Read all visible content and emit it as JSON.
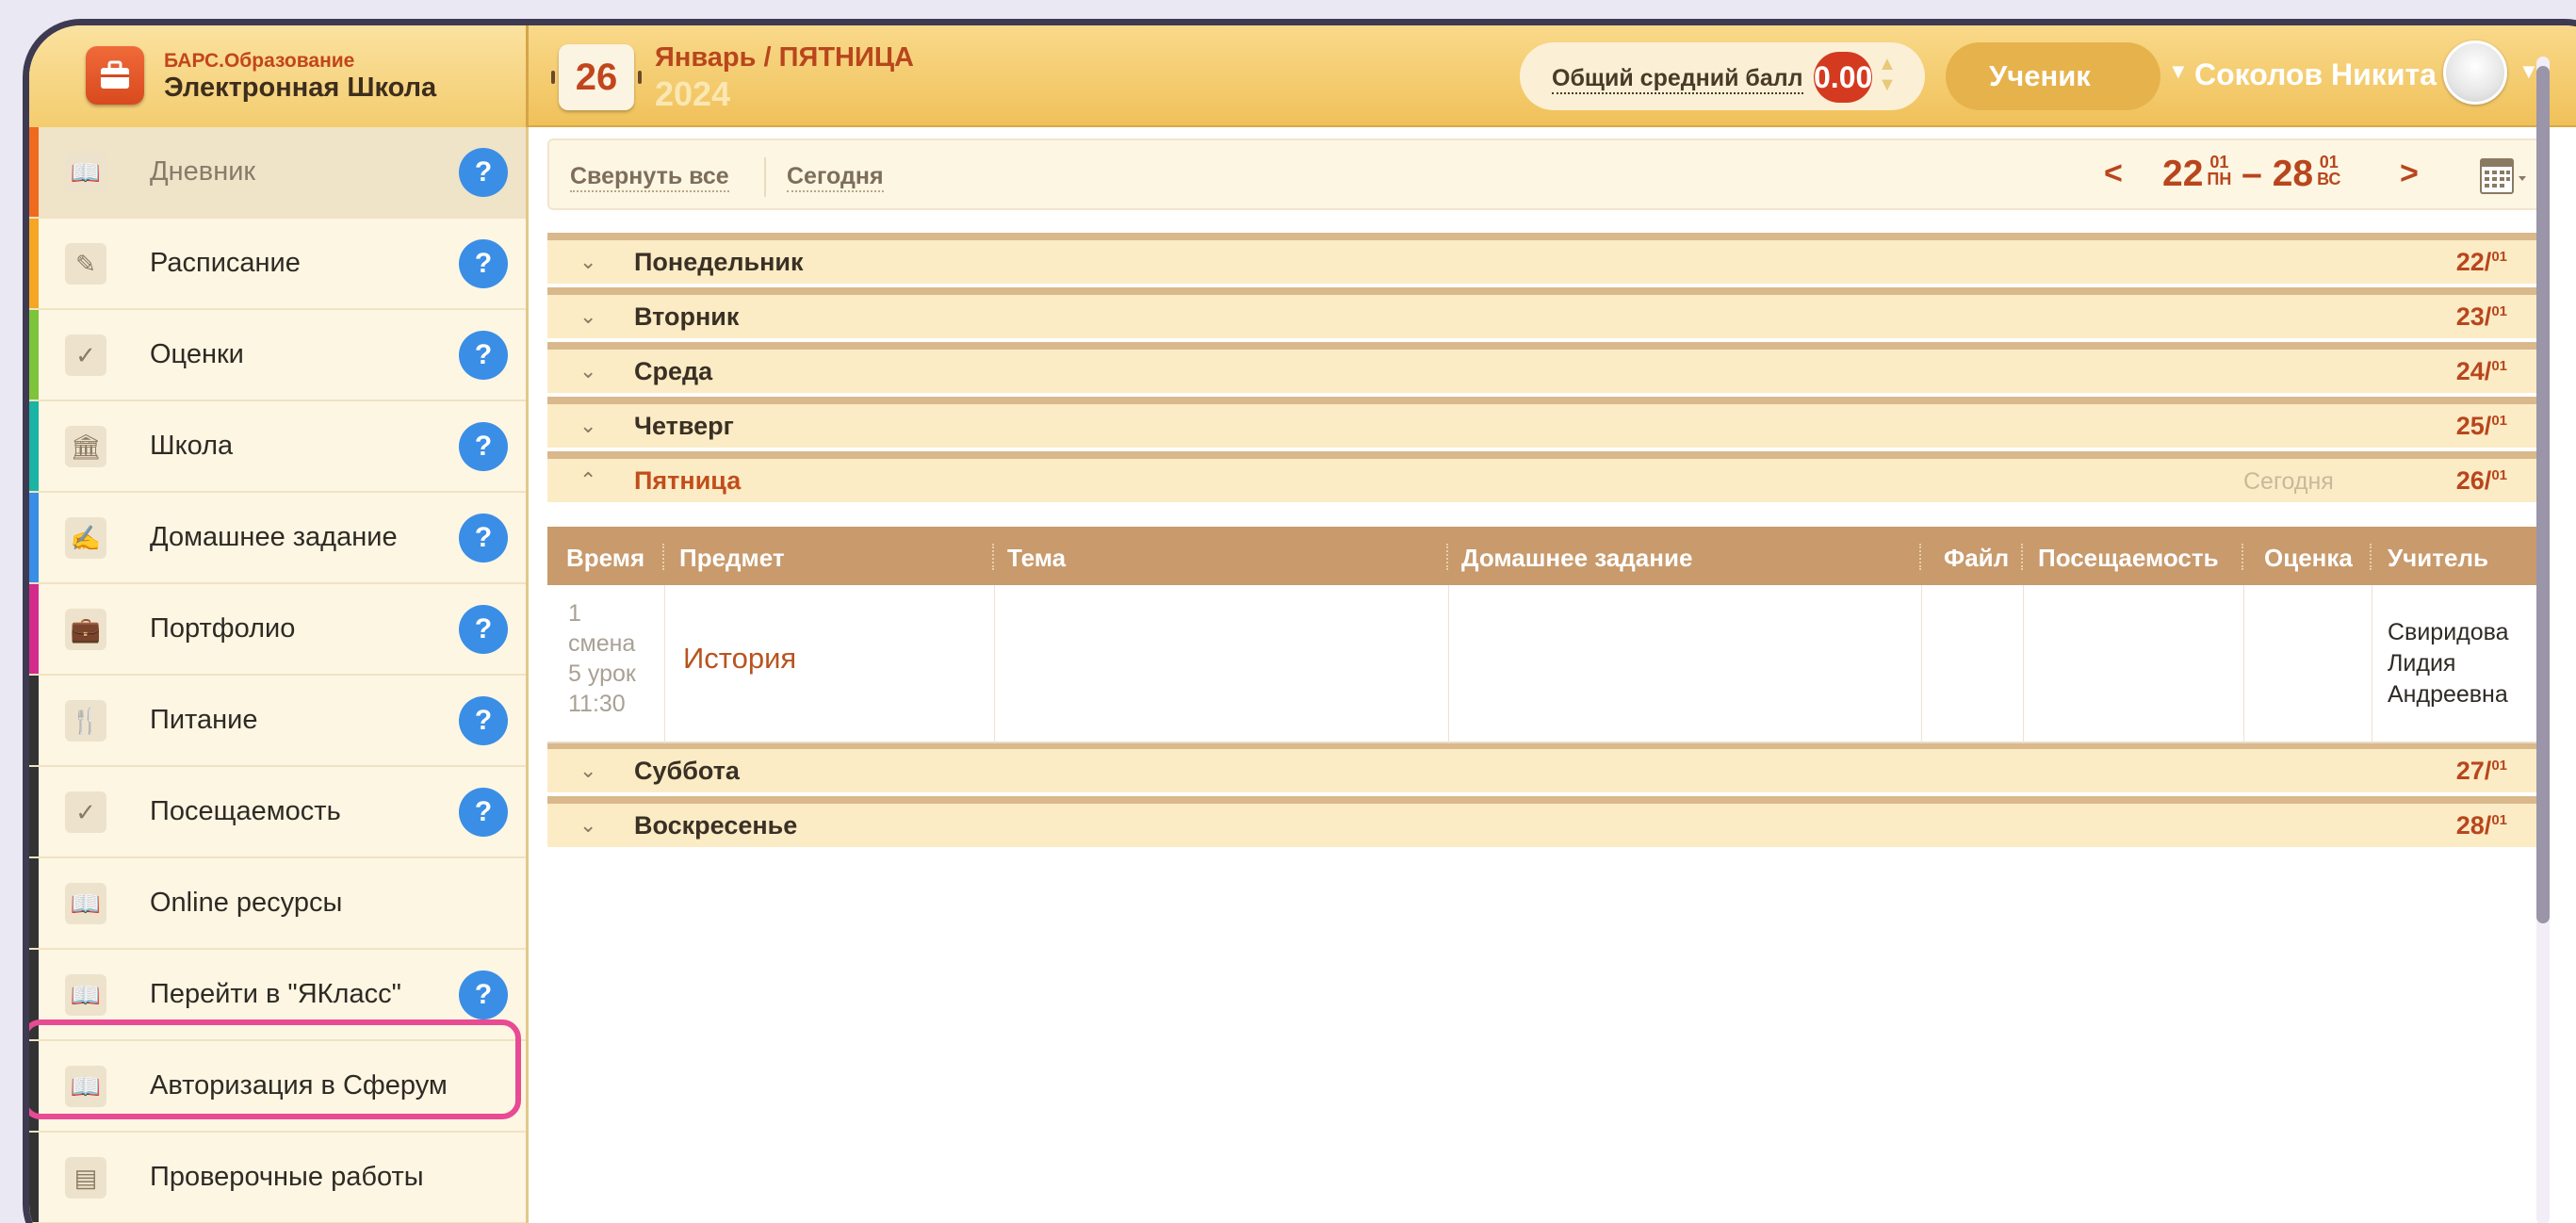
{
  "app": {
    "brand_line1": "БАРС.Образование",
    "brand_line2": "Электронная Школа"
  },
  "header": {
    "day_number": "26",
    "month_weekday": "Январь / ПЯТНИЦА",
    "year": "2024",
    "avg_label": "Общий средний балл",
    "avg_value": "0.00",
    "role": "Ученик",
    "user_name": "Соколов Никита"
  },
  "sidebar": {
    "items": [
      {
        "label": "Дневник",
        "icon": "book-icon",
        "help": "?",
        "stripe": "#f06a1e"
      },
      {
        "label": "Расписание",
        "icon": "pen-icon",
        "help": "?",
        "stripe": "#f5a623"
      },
      {
        "label": "Оценки",
        "icon": "check-icon",
        "help": "?",
        "stripe": "#7dc43a"
      },
      {
        "label": "Школа",
        "icon": "school-icon",
        "help": "?",
        "stripe": "#1bb3a3"
      },
      {
        "label": "Домашнее задание",
        "icon": "homework-icon",
        "help": "?",
        "stripe": "#3a8ee6"
      },
      {
        "label": "Портфолио",
        "icon": "briefcase-icon",
        "help": "?",
        "stripe": "#d42a8c"
      },
      {
        "label": "Питание",
        "icon": "utensils-icon",
        "help": "?",
        "stripe": "#333333"
      },
      {
        "label": "Посещаемость",
        "icon": "check-icon",
        "help": "?",
        "stripe": "#333333"
      },
      {
        "label": "Online ресурсы",
        "icon": "book-icon",
        "help": "",
        "stripe": "#333333"
      },
      {
        "label": "Перейти в \"ЯКласс\"",
        "icon": "book-icon",
        "help": "?",
        "stripe": "#333333"
      },
      {
        "label": "Авторизация в Сферум",
        "icon": "book-icon",
        "help": "",
        "stripe": "#333333"
      },
      {
        "label": "Проверочные работы",
        "icon": "document-icon",
        "help": "",
        "stripe": "#333333"
      }
    ]
  },
  "toolbar": {
    "collapse_all": "Свернуть все",
    "today": "Сегодня",
    "range_start_day": "22",
    "range_start_month": "01",
    "range_start_weekday": "ПН",
    "range_dash": "–",
    "range_end_day": "28",
    "range_end_month": "01",
    "range_end_weekday": "ВС"
  },
  "days": [
    {
      "name": "Понедельник",
      "day": "22",
      "month": "01"
    },
    {
      "name": "Вторник",
      "day": "23",
      "month": "01"
    },
    {
      "name": "Среда",
      "day": "24",
      "month": "01"
    },
    {
      "name": "Четверг",
      "day": "25",
      "month": "01"
    },
    {
      "name": "Пятница",
      "day": "26",
      "month": "01",
      "today_label": "Сегодня"
    },
    {
      "name": "Суббота",
      "day": "27",
      "month": "01"
    },
    {
      "name": "Воскресенье",
      "day": "28",
      "month": "01"
    }
  ],
  "table": {
    "columns": [
      "Время",
      "Предмет",
      "Тема",
      "Домашнее задание",
      "Файл",
      "Посещаемость",
      "Оценка",
      "Учитель"
    ],
    "rows": [
      {
        "time": [
          "1",
          "смена",
          "5 урок",
          "11:30"
        ],
        "subject": "История",
        "topic": "",
        "homework": "",
        "file": "",
        "attendance": "",
        "grade": "",
        "teacher": [
          "Свиридова",
          "Лидия",
          "Андреевна"
        ]
      }
    ]
  },
  "colors": {
    "accent": "#b8461d",
    "header_bg": "#f0c15a",
    "help_badge": "#3a8ee6",
    "highlight_border": "#e84a94"
  }
}
